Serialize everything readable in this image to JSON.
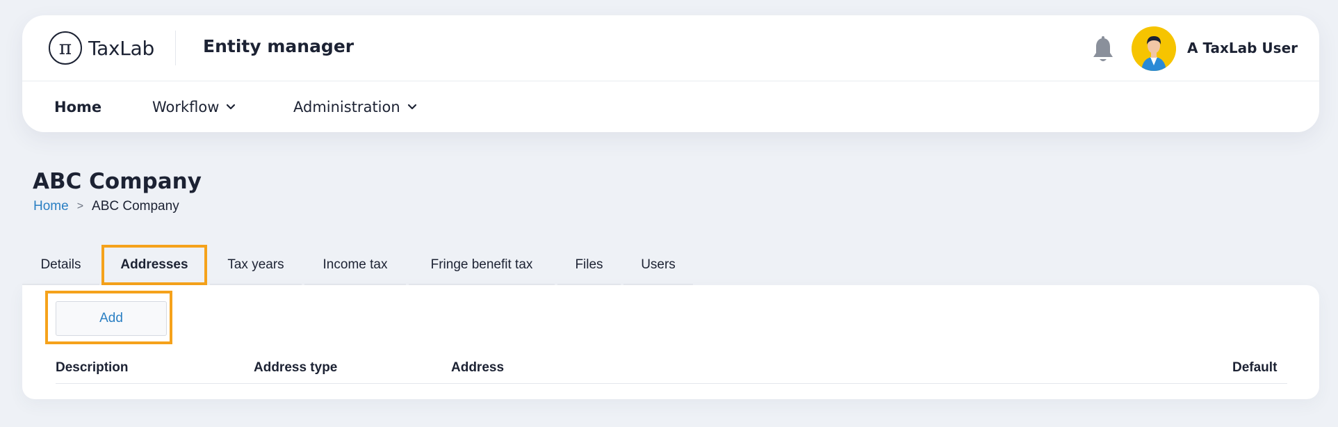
{
  "header": {
    "logo_text": "TaxLab",
    "logo_symbol": "π",
    "app_title": "Entity manager",
    "user_name": "A TaxLab User",
    "icons": [
      "bell-icon",
      "avatar"
    ]
  },
  "nav": {
    "items": [
      {
        "label": "Home",
        "active": true,
        "has_dropdown": false
      },
      {
        "label": "Workflow",
        "active": false,
        "has_dropdown": true
      },
      {
        "label": "Administration",
        "active": false,
        "has_dropdown": true
      }
    ]
  },
  "page": {
    "title": "ABC Company",
    "breadcrumb": [
      {
        "label": "Home",
        "link": true
      },
      {
        "label": "ABC Company",
        "link": false
      }
    ],
    "breadcrumb_separator": ">"
  },
  "tabs": [
    {
      "label": "Details",
      "active": false
    },
    {
      "label": "Addresses",
      "active": true
    },
    {
      "label": "Tax years",
      "active": false
    },
    {
      "label": "Income tax",
      "active": false
    },
    {
      "label": "Fringe benefit tax",
      "active": false
    },
    {
      "label": "Files",
      "active": false
    },
    {
      "label": "Users",
      "active": false
    }
  ],
  "addresses": {
    "add_label": "Add",
    "columns": [
      "Description",
      "Address type",
      "Address",
      "Default"
    ]
  },
  "colors": {
    "accent_link": "#2a7fc3",
    "highlight": "#f5a21b",
    "background": "#eef1f6"
  }
}
